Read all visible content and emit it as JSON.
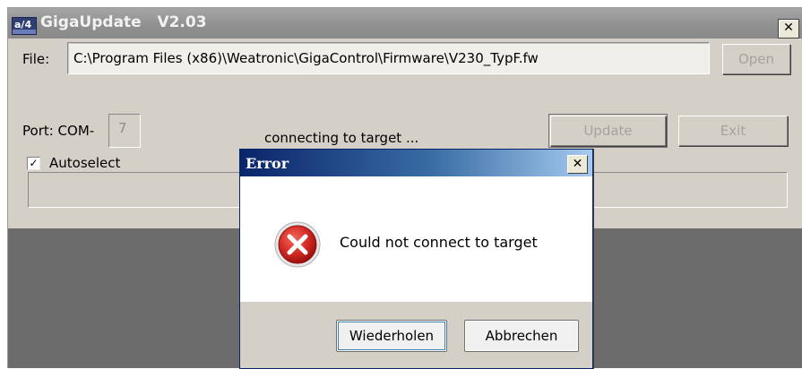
{
  "window": {
    "title": "GigaUpdate   V2.03",
    "close_glyph": "✕",
    "app_icon_glyph": "a/4"
  },
  "form": {
    "file_label": "File:",
    "file_path": "C:\\Program Files (x86)\\Weatronic\\GigaControl\\Firmware\\V230_TypF.fw",
    "open_label": "Open",
    "port_label": "Port: COM-",
    "com_port": "7",
    "status": "connecting to target ...",
    "update_label": "Update",
    "exit_label": "Exit",
    "autoselect_label": "Autoselect",
    "autoselect_checked": true,
    "check_glyph": "✓"
  },
  "dialog": {
    "title": "Error",
    "close_glyph": "✕",
    "message": "Could not connect to target",
    "retry_label": "Wiederholen",
    "cancel_label": "Abbrechen"
  },
  "colors": {
    "dialog_title_start": "#0a246a",
    "dialog_title_end": "#a6caf0",
    "error_icon": "#c4211f",
    "window_bg": "#d4d0c8"
  },
  "icons": {
    "error": "error-circle-x-icon",
    "app": "gigaupdate-app-icon",
    "checkbox": "check-icon"
  }
}
